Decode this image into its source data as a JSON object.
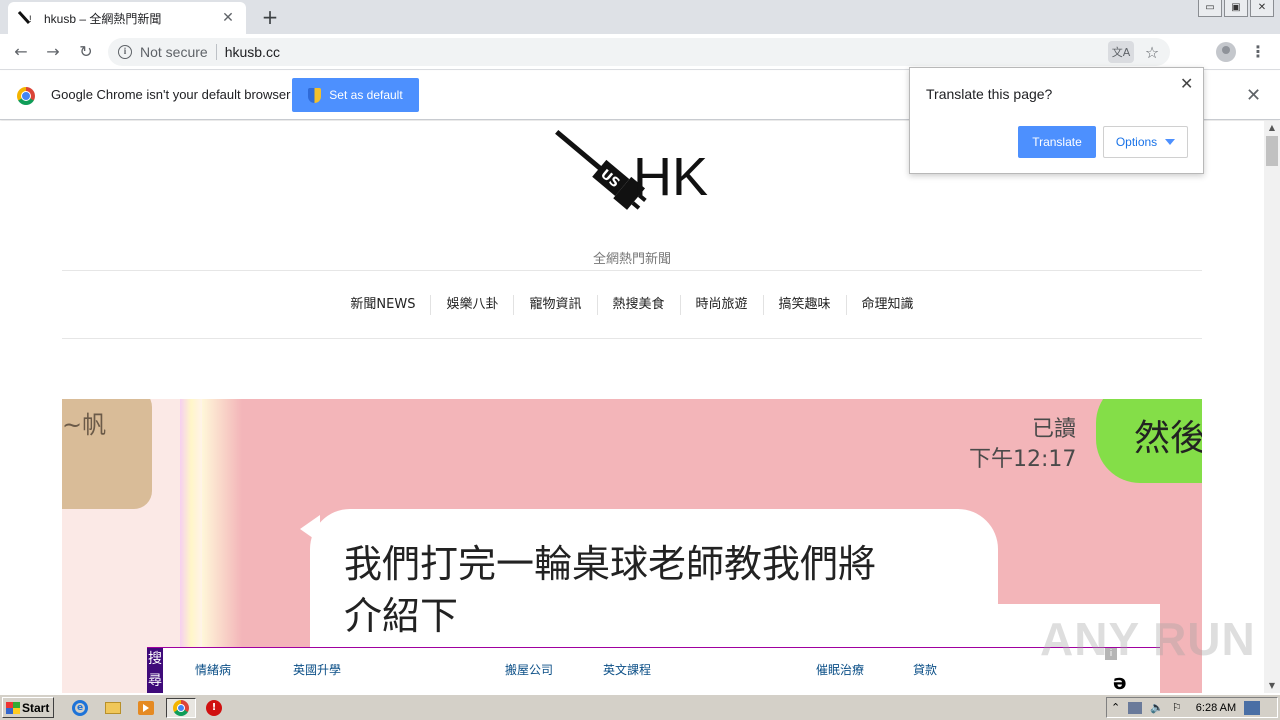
{
  "tab": {
    "title": "hkusb – 全網熱門新聞",
    "close_icon": "✕",
    "new_tab_icon": "+"
  },
  "window_controls": {
    "minimize": "▭",
    "restore": "▣",
    "close": "✕"
  },
  "toolbar": {
    "back_icon": "←",
    "forward_icon": "→",
    "reload_icon": "↻",
    "info_icon": "i",
    "security": "Not secure",
    "url": "hkusb.cc",
    "translate_icon": "文A",
    "star_icon": "☆",
    "menu_icon": "⋮"
  },
  "infobar": {
    "message": "Google Chrome isn't your default browser",
    "button": "Set as default",
    "close_icon": "✕"
  },
  "translate_popup": {
    "question": "Translate this page?",
    "translate_button": "Translate",
    "options_button": "Options",
    "close_icon": "✕"
  },
  "site": {
    "logo_text": "HK",
    "tagline": "全網熱門新聞",
    "nav": [
      "新聞NEWS",
      "娛樂八卦",
      "寵物資訊",
      "熱搜美食",
      "時尚旅遊",
      "搞笑趣味",
      "命理知識"
    ]
  },
  "hero": {
    "tan_text": "~帆",
    "read_label": "已讀",
    "time": "下午12:17",
    "green_text": "然後",
    "bubble_line1": "我們打完一輪桌球老師教我們將",
    "bubble_line2": "介紹下"
  },
  "adbar": {
    "tag": "搜尋",
    "links": [
      "情緒病",
      "英國升學",
      "搬屋公司",
      "英文課程",
      "催眠治療",
      "貸款"
    ],
    "mini": "i",
    "side": "ǝ"
  },
  "watermark": "ANY RUN",
  "scrollbar": {
    "up": "▲",
    "down": "▼"
  },
  "taskbar": {
    "start": "Start",
    "clock": "6:28 AM",
    "ie_glyph": "e",
    "stop_glyph": "!"
  },
  "colors": {
    "accent": "#4d90fe",
    "hero_pink": "#f3b5b9",
    "line_green": "#84de48"
  }
}
